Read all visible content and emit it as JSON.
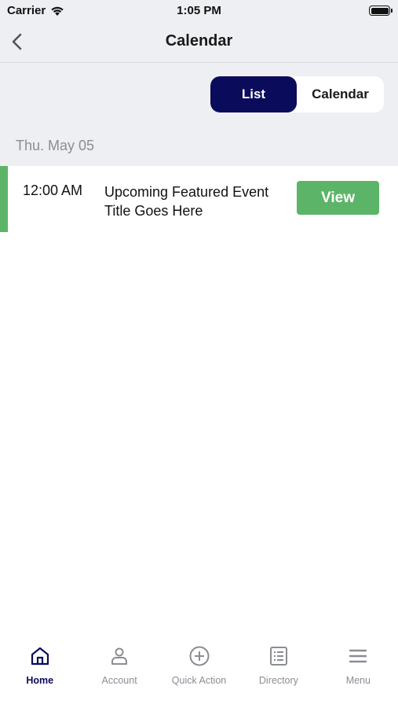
{
  "status_bar": {
    "carrier": "Carrier",
    "time": "1:05 PM"
  },
  "nav": {
    "title": "Calendar"
  },
  "segmented": {
    "options": [
      "List",
      "Calendar"
    ],
    "selected": "List"
  },
  "day": {
    "date_label": "Thu. May 05",
    "events": [
      {
        "time": "12:00 AM",
        "title": "Upcoming Featured Event Title Goes Here",
        "action": "View"
      }
    ]
  },
  "tab_bar": {
    "items": [
      {
        "label": "Home",
        "icon": "home-icon",
        "active": true
      },
      {
        "label": "Account",
        "icon": "account-icon",
        "active": false
      },
      {
        "label": "Quick Action",
        "icon": "plus-circle-icon",
        "active": false
      },
      {
        "label": "Directory",
        "icon": "list-icon",
        "active": false
      },
      {
        "label": "Menu",
        "icon": "hamburger-icon",
        "active": false
      }
    ]
  },
  "colors": {
    "primary": "#0b0b5c",
    "accent_green": "#5cb468",
    "background_gray": "#eeeff2"
  }
}
